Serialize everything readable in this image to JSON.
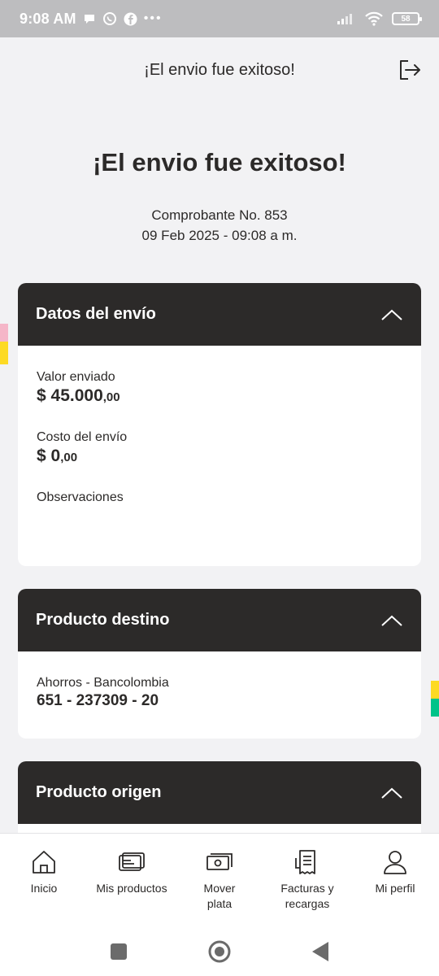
{
  "status_bar": {
    "time": "9:08 AM",
    "dots": "•••",
    "battery": "58"
  },
  "header": {
    "title": "¡El envio fue exitoso!"
  },
  "hero": {
    "title": "¡El envio fue exitoso!",
    "receipt": "Comprobante No. 853",
    "datetime": "09 Feb 2025 - 09:08 a m."
  },
  "sections": {
    "envio": {
      "title": "Datos del envío",
      "valor_label": "Valor enviado",
      "valor_amount": "$ 45.000",
      "valor_cents": ",00",
      "costo_label": "Costo del envío",
      "costo_amount": "$ 0",
      "costo_cents": ",00",
      "obs_label": "Observaciones"
    },
    "destino": {
      "title": "Producto destino",
      "account_type": "Ahorros - Bancolombia",
      "account_number": "651 - 237309 - 20"
    },
    "origen": {
      "title": "Producto origen"
    }
  },
  "bottom_nav": [
    {
      "label": "Inicio",
      "icon": "home-icon"
    },
    {
      "label": "Mis productos",
      "icon": "card-icon"
    },
    {
      "label": "Mover plata",
      "icon": "money-icon"
    },
    {
      "label": "Facturas y recargas",
      "icon": "receipt-icon"
    },
    {
      "label": "Mi perfil",
      "icon": "user-icon"
    }
  ],
  "colors": {
    "dark": "#2c2a29",
    "background": "#f2f2f4",
    "yellow": "#fdda24",
    "green": "#00c389",
    "pink": "#f5b6c8"
  }
}
